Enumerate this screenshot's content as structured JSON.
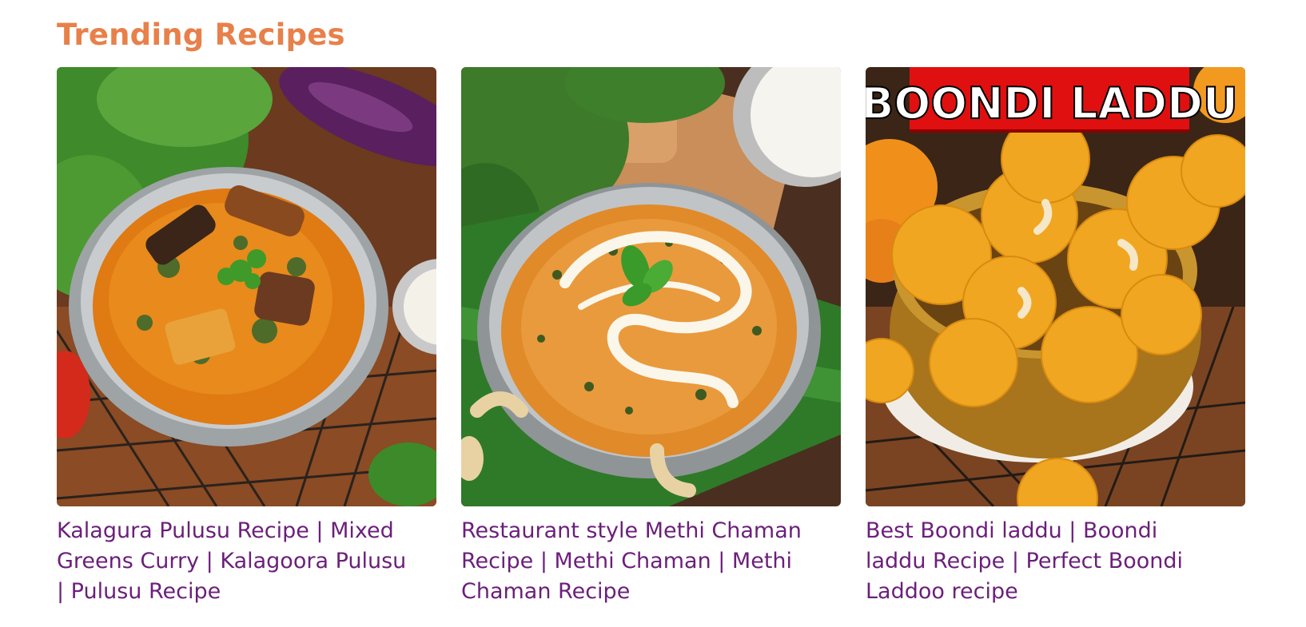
{
  "section": {
    "title": "Trending Recipes"
  },
  "colors": {
    "title": "#e8804a",
    "card_title": "#6b1f7a"
  },
  "recipes": [
    {
      "title": "Kalagura Pulusu Recipe | Mixed Greens Curry | Kalagoora Pulusu | Pulusu Recipe",
      "image": "kalagura-pulusu-photo"
    },
    {
      "title": "Restaurant style Methi Chaman Recipe | Methi Chaman | Methi Chaman Recipe",
      "image": "methi-chaman-photo"
    },
    {
      "title": "Best Boondi laddu | Boondi laddu Recipe | Perfect Boondi Laddoo recipe",
      "image": "boondi-laddu-photo",
      "image_banner": "BOONDI LADDU"
    }
  ]
}
